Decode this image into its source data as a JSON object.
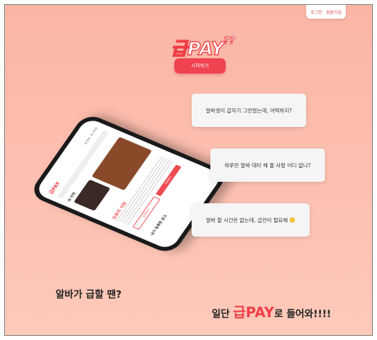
{
  "header": {
    "login_label": "로그인",
    "signup_label": "회원가입"
  },
  "logo": {
    "brand_text": "급PAY",
    "sparkle": "??"
  },
  "hero": {
    "start_label": "시작하기"
  },
  "bubbles": [
    {
      "text": "알바생이 갑자기 그만뒀는데, 어떡하지?"
    },
    {
      "text": "하루만 알바 대타 해 줄 사람 어디 없나?"
    },
    {
      "text": "알바 할 시간은 없는데, 급전이 필요해"
    }
  ],
  "phone_screen": {
    "logo": "급PAY",
    "nav": [
      "내 정보",
      "로그아웃"
    ],
    "section_title": "내 지역",
    "store_name": "오토리 식당",
    "button_secondary": "상세보기",
    "button_primary": "지원하기",
    "sub_title": "내가 등록한 공고"
  },
  "tagline": {
    "line1": "알바가 급할 땐?",
    "line2_prefix": "일단 ",
    "line2_brand": "급PAY",
    "line2_suffix": "로 들어와!!!!"
  },
  "colors": {
    "brand": "#ef3f47",
    "bg_top": "#fbb5a5",
    "bg_bottom": "#fdcab9",
    "bubble": "#f5f5f5"
  }
}
